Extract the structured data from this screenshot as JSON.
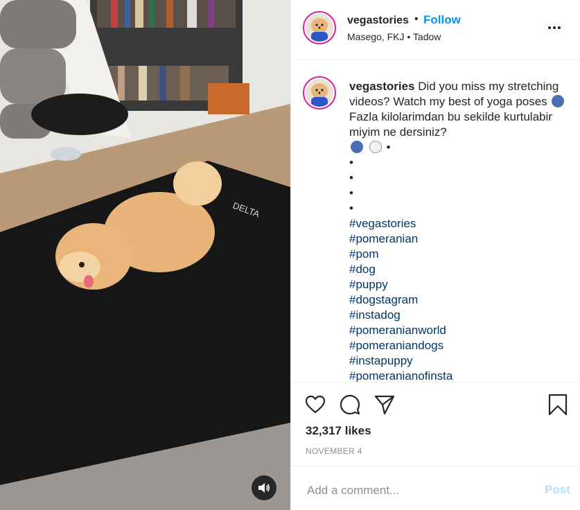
{
  "post": {
    "username": "vegastories",
    "dot": "•",
    "follow_label": "Follow",
    "location": "Masego, FKJ",
    "location_sep": "•",
    "location_audio": "Tadow"
  },
  "caption": {
    "username": "vegastories",
    "line1": "Did you miss my stretching videos? Watch my best of yoga poses",
    "line2": "Fazla kilolarimdan bu sekilde kurtulabir miyim ne dersiniz?",
    "after_emoji": "•",
    "bullets": [
      "•",
      "•",
      "•",
      "•"
    ],
    "hashtags": [
      "#vegastories",
      "#pomeranian",
      "#pom",
      "#dog",
      "#puppy",
      "#dogstagram",
      "#instadog",
      "#pomeranianworld",
      "#pomeraniandogs",
      "#instapuppy",
      "#pomeranianofinsta"
    ]
  },
  "engagement": {
    "likes": "32,317 likes",
    "date": "NOVEMBER 4"
  },
  "comment": {
    "placeholder": "Add a comment...",
    "post_label": "Post"
  },
  "icons": {
    "heart": "heart-icon",
    "comment": "comment-icon",
    "share": "share-icon",
    "save": "bookmark-icon",
    "more": "more-options-icon",
    "sound": "speaker-icon"
  },
  "colors": {
    "accent": "#0095f6",
    "hashtag": "#00376b",
    "post_disabled": "#b2dffc",
    "story_ring": "#d6249f"
  }
}
